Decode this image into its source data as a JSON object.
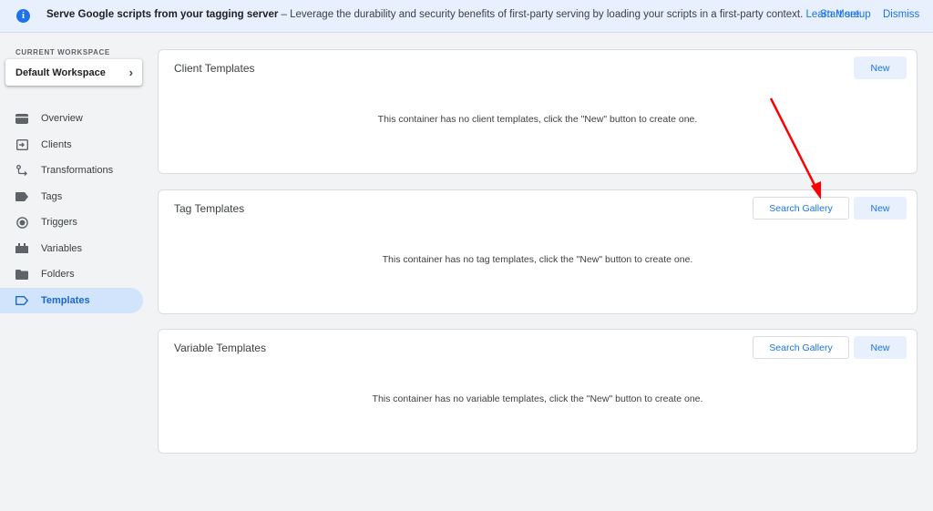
{
  "banner": {
    "title": "Serve Google scripts from your tagging server",
    "body": " – Leverage the durability and security benefits of first-party serving by loading your scripts in a first-party context. ",
    "learn_more": "Learn More.",
    "start_setup": "Start setup",
    "dismiss": "Dismiss"
  },
  "workspace": {
    "label": "CURRENT WORKSPACE",
    "name": "Default Workspace"
  },
  "nav": {
    "items": [
      {
        "label": "Overview",
        "icon": "overview-icon"
      },
      {
        "label": "Clients",
        "icon": "clients-icon"
      },
      {
        "label": "Transformations",
        "icon": "transformations-icon"
      },
      {
        "label": "Tags",
        "icon": "tag-icon"
      },
      {
        "label": "Triggers",
        "icon": "trigger-icon"
      },
      {
        "label": "Variables",
        "icon": "variables-icon"
      },
      {
        "label": "Folders",
        "icon": "folder-icon"
      },
      {
        "label": "Templates",
        "icon": "template-icon",
        "active": true
      }
    ]
  },
  "cards": {
    "client": {
      "title": "Client Templates",
      "empty": "This container has no client templates, click the \"New\" button to create one.",
      "new_label": "New"
    },
    "tag": {
      "title": "Tag Templates",
      "empty": "This container has no tag templates, click the \"New\" button to create one.",
      "gallery_label": "Search Gallery",
      "new_label": "New"
    },
    "variable": {
      "title": "Variable Templates",
      "empty": "This container has no variable templates, click the \"New\" button to create one.",
      "gallery_label": "Search Gallery",
      "new_label": "New"
    }
  },
  "colors": {
    "accent": "#1a73e8",
    "active_bg": "#d2e3fc",
    "annotation_arrow": "#ff0000"
  }
}
